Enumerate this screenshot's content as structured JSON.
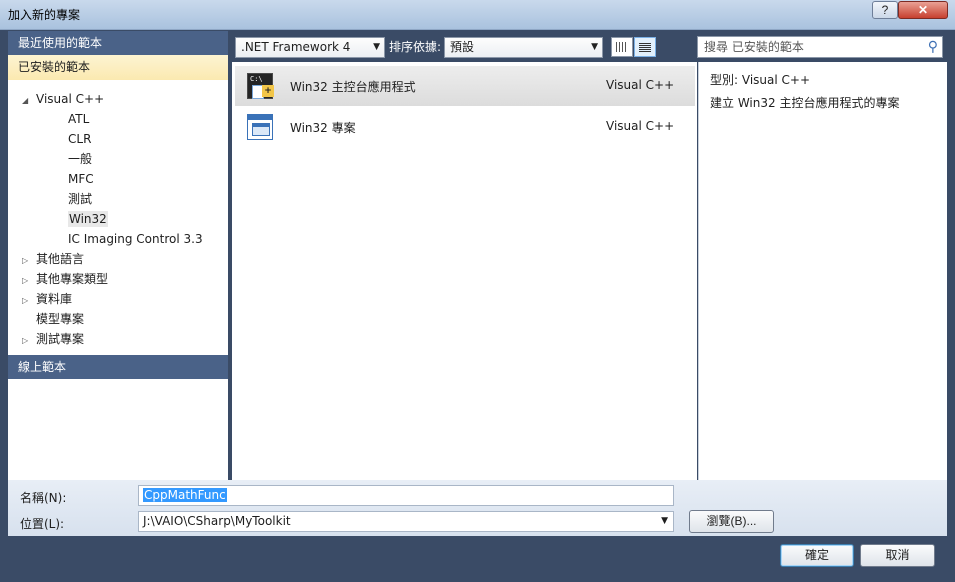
{
  "window": {
    "title": "加入新的專案",
    "help_label": "?",
    "close_label": "✕"
  },
  "left_pane": {
    "recent_header": "最近使用的範本",
    "installed_header": "已安裝的範本",
    "online_header": "線上範本",
    "tree": [
      {
        "label": "Visual C++",
        "expander": "◢",
        "level": 0
      },
      {
        "label": "ATL",
        "expander": "",
        "level": 1
      },
      {
        "label": "CLR",
        "expander": "",
        "level": 1
      },
      {
        "label": "一般",
        "expander": "",
        "level": 1
      },
      {
        "label": "MFC",
        "expander": "",
        "level": 1
      },
      {
        "label": "測試",
        "expander": "",
        "level": 1
      },
      {
        "label": "Win32",
        "expander": "",
        "level": 1,
        "selected": true
      },
      {
        "label": "IC Imaging Control 3.3",
        "expander": "",
        "level": 1
      },
      {
        "label": "其他語言",
        "expander": "▷",
        "level": 0
      },
      {
        "label": "其他專案類型",
        "expander": "▷",
        "level": 0
      },
      {
        "label": "資料庫",
        "expander": "▷",
        "level": 0
      },
      {
        "label": "模型專案",
        "expander": "",
        "level": 0
      },
      {
        "label": "測試專案",
        "expander": "▷",
        "level": 0
      }
    ]
  },
  "toolbar": {
    "framework": ".NET Framework 4",
    "sort_label": "排序依據:",
    "sort_value": "預設",
    "search_placeholder": "搜尋 已安裝的範本"
  },
  "templates": [
    {
      "name": "Win32 主控台應用程式",
      "language": "Visual C++",
      "icon": "console-app-icon",
      "selected": true
    },
    {
      "name": "Win32 專案",
      "language": "Visual C++",
      "icon": "win32-project-icon",
      "selected": false
    }
  ],
  "detail": {
    "type_label": "型別:",
    "type_value": "Visual C++",
    "description": "建立 Win32 主控台應用程式的專案"
  },
  "form": {
    "name_label": "名稱(N):",
    "name_value": "CppMathFunc",
    "location_label": "位置(L):",
    "location_value": "J:\\VAIO\\CSharp\\MyToolkit",
    "browse_label": "瀏覽(B)...",
    "ok_label": "確定",
    "cancel_label": "取消"
  }
}
